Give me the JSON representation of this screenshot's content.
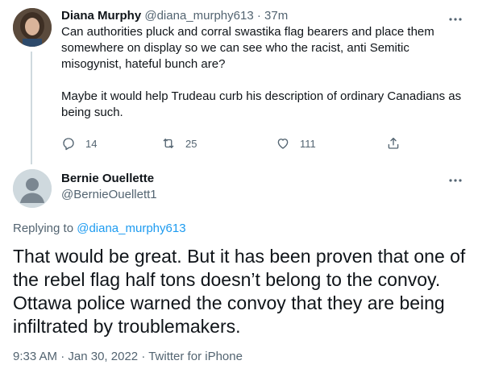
{
  "parent_tweet": {
    "display_name": "Diana Murphy",
    "handle": "@diana_murphy613",
    "separator": "·",
    "time": "37m",
    "text_p1": "Can authorities pluck and corral swastika flag bearers and place them somewhere on display so we can see who the racist, anti Semitic misogynist, hateful bunch are?",
    "text_p2": "Maybe it would help Trudeau curb his description of ordinary Canadians as being such.",
    "replies_count": "14",
    "retweets_count": "25",
    "likes_count": "111"
  },
  "reply_tweet": {
    "display_name": "Bernie Ouellette",
    "handle": "@BernieOuellett1",
    "replying_label": "Replying to",
    "replying_to": "@diana_murphy613",
    "text": "That would be great. But it has been proven that one of the rebel flag half tons doesn’t belong to the convoy. Ottawa police warned the convoy that they are being infiltrated by troublemakers.",
    "time": "9:33 AM",
    "separator": "·",
    "date": "Jan 30, 2022",
    "source": "Twitter for iPhone"
  },
  "icons": [
    "more-icon",
    "reply-icon",
    "retweet-icon",
    "like-icon",
    "share-icon",
    "default-avatar-icon"
  ],
  "colors": {
    "text_primary": "#0f1419",
    "text_secondary": "#536471",
    "link": "#1d9bf0",
    "thread_line": "#cfd9de",
    "default_avatar_bg": "#cfd9de"
  }
}
